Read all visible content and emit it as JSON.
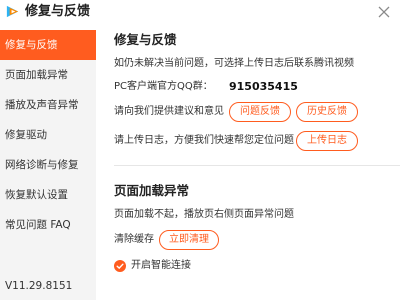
{
  "app": {
    "title": "修复与反馈"
  },
  "sidebar": {
    "items": [
      {
        "label": "修复与反馈"
      },
      {
        "label": "页面加载异常"
      },
      {
        "label": "播放及声音异常"
      },
      {
        "label": "修复驱动"
      },
      {
        "label": "网络诊断与修复"
      },
      {
        "label": "恢复默认设置"
      },
      {
        "label": "常见问题 FAQ"
      }
    ],
    "active_index": 0,
    "version": "V11.29.8151"
  },
  "feedback_section": {
    "title": "修复与反馈",
    "description": "如仍未解决当前问题，可选择上传日志后联系腾讯视频",
    "qq_label": "PC客户端官方QQ群：",
    "qq_number": "915035415",
    "suggestion_text": "请向我们提供建议和意见",
    "problem_feedback_button": "问题反馈",
    "history_feedback_button": "历史反馈",
    "upload_text": "请上传日志，方便我们快速帮您定位问题",
    "upload_log_button": "上传日志"
  },
  "page_load_section": {
    "title": "页面加载异常",
    "description": "页面加载不起，播放页右侧页面异常问题",
    "clear_cache_label": "清除缓存",
    "clean_now_button": "立即清理",
    "smart_connect_label": "开启智能连接",
    "smart_connect_checked": true
  },
  "colors": {
    "accent": "#ff5c1f",
    "sidebar_bg": "#f4f4f4",
    "divider": "#e6e6e6"
  },
  "icons": {
    "logo": "tencent-video-logo-icon",
    "close": "close-icon",
    "check": "checkmark-icon"
  }
}
